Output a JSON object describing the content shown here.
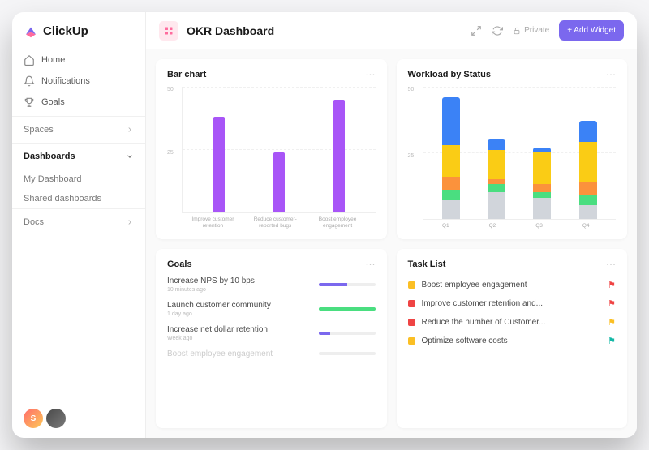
{
  "brand": "ClickUp",
  "nav": {
    "home": "Home",
    "notifications": "Notifications",
    "goals": "Goals"
  },
  "sections": {
    "spaces": "Spaces",
    "dashboards": "Dashboards",
    "my_dashboard": "My Dashboard",
    "shared": "Shared dashboards",
    "docs": "Docs"
  },
  "avatar_initial": "S",
  "header": {
    "title": "OKR Dashboard",
    "private": "Private",
    "add_widget": "+ Add Widget"
  },
  "cards": {
    "bar": {
      "title": "Bar chart",
      "ymax": "50",
      "ymid": "25"
    },
    "workload": {
      "title": "Workload by Status",
      "ymax": "50",
      "ymid": "25"
    },
    "goals": {
      "title": "Goals"
    },
    "tasks": {
      "title": "Task List"
    }
  },
  "goals": [
    {
      "name": "Increase NPS by 10 bps",
      "time": "10 minutes ago",
      "pct": 50,
      "color": "#7b68ee"
    },
    {
      "name": "Launch customer community",
      "time": "1 day ago",
      "pct": 100,
      "color": "#4ade80"
    },
    {
      "name": "Increase net dollar retention",
      "time": "Week ago",
      "pct": 20,
      "color": "#7b68ee"
    },
    {
      "name": "Boost employee engagement",
      "time": "",
      "pct": 0,
      "color": "#ccc",
      "faded": true
    }
  ],
  "tasks": [
    {
      "name": "Boost employee engagement",
      "sq": "#fbbf24",
      "flag": "#ef4444"
    },
    {
      "name": "Improve customer retention and...",
      "sq": "#ef4444",
      "flag": "#ef4444"
    },
    {
      "name": "Reduce the number of Customer...",
      "sq": "#ef4444",
      "flag": "#fbbf24"
    },
    {
      "name": "Optimize software costs",
      "sq": "#fbbf24",
      "flag": "#14b8a6"
    }
  ],
  "chart_data": [
    {
      "type": "bar",
      "title": "Bar chart",
      "ylabel": "",
      "xlabel": "",
      "ylim": [
        0,
        50
      ],
      "categories": [
        "Improve customer retention",
        "Reduce customer-reported bugs",
        "Boost employee engagement"
      ],
      "values": [
        38,
        24,
        45
      ],
      "color": "#a855f7"
    },
    {
      "type": "bar",
      "stacked": true,
      "title": "Workload by Status",
      "ylabel": "",
      "xlabel": "",
      "ylim": [
        0,
        50
      ],
      "categories": [
        "Q1",
        "Q2",
        "Q3",
        "Q4"
      ],
      "series": [
        {
          "name": "grey",
          "color": "#d1d5db",
          "values": [
            7,
            10,
            8,
            5
          ]
        },
        {
          "name": "green",
          "color": "#4ade80",
          "values": [
            4,
            3,
            2,
            4
          ]
        },
        {
          "name": "orange",
          "color": "#fb923c",
          "values": [
            5,
            2,
            3,
            5
          ]
        },
        {
          "name": "yellow",
          "color": "#facc15",
          "values": [
            12,
            11,
            12,
            15
          ]
        },
        {
          "name": "blue",
          "color": "#3b82f6",
          "values": [
            18,
            4,
            2,
            8
          ]
        }
      ]
    }
  ]
}
